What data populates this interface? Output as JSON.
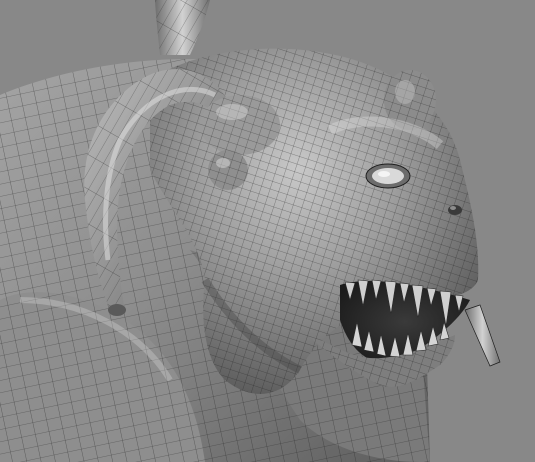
{
  "viewport": {
    "background_color": "#888888",
    "model_surface_color": "#9a9a9a",
    "wireframe_color": "#1e1e1e",
    "highlight_color": "#e6e6e6"
  },
  "model": {
    "subject": "demon-creature-head",
    "display_mode": "shaded-with-wireframe",
    "parts": [
      "horn-upper",
      "horn-curved",
      "ear",
      "eye",
      "nostril",
      "jaw-upper",
      "jaw-lower",
      "teeth",
      "tusk",
      "neck",
      "shoulder"
    ]
  }
}
